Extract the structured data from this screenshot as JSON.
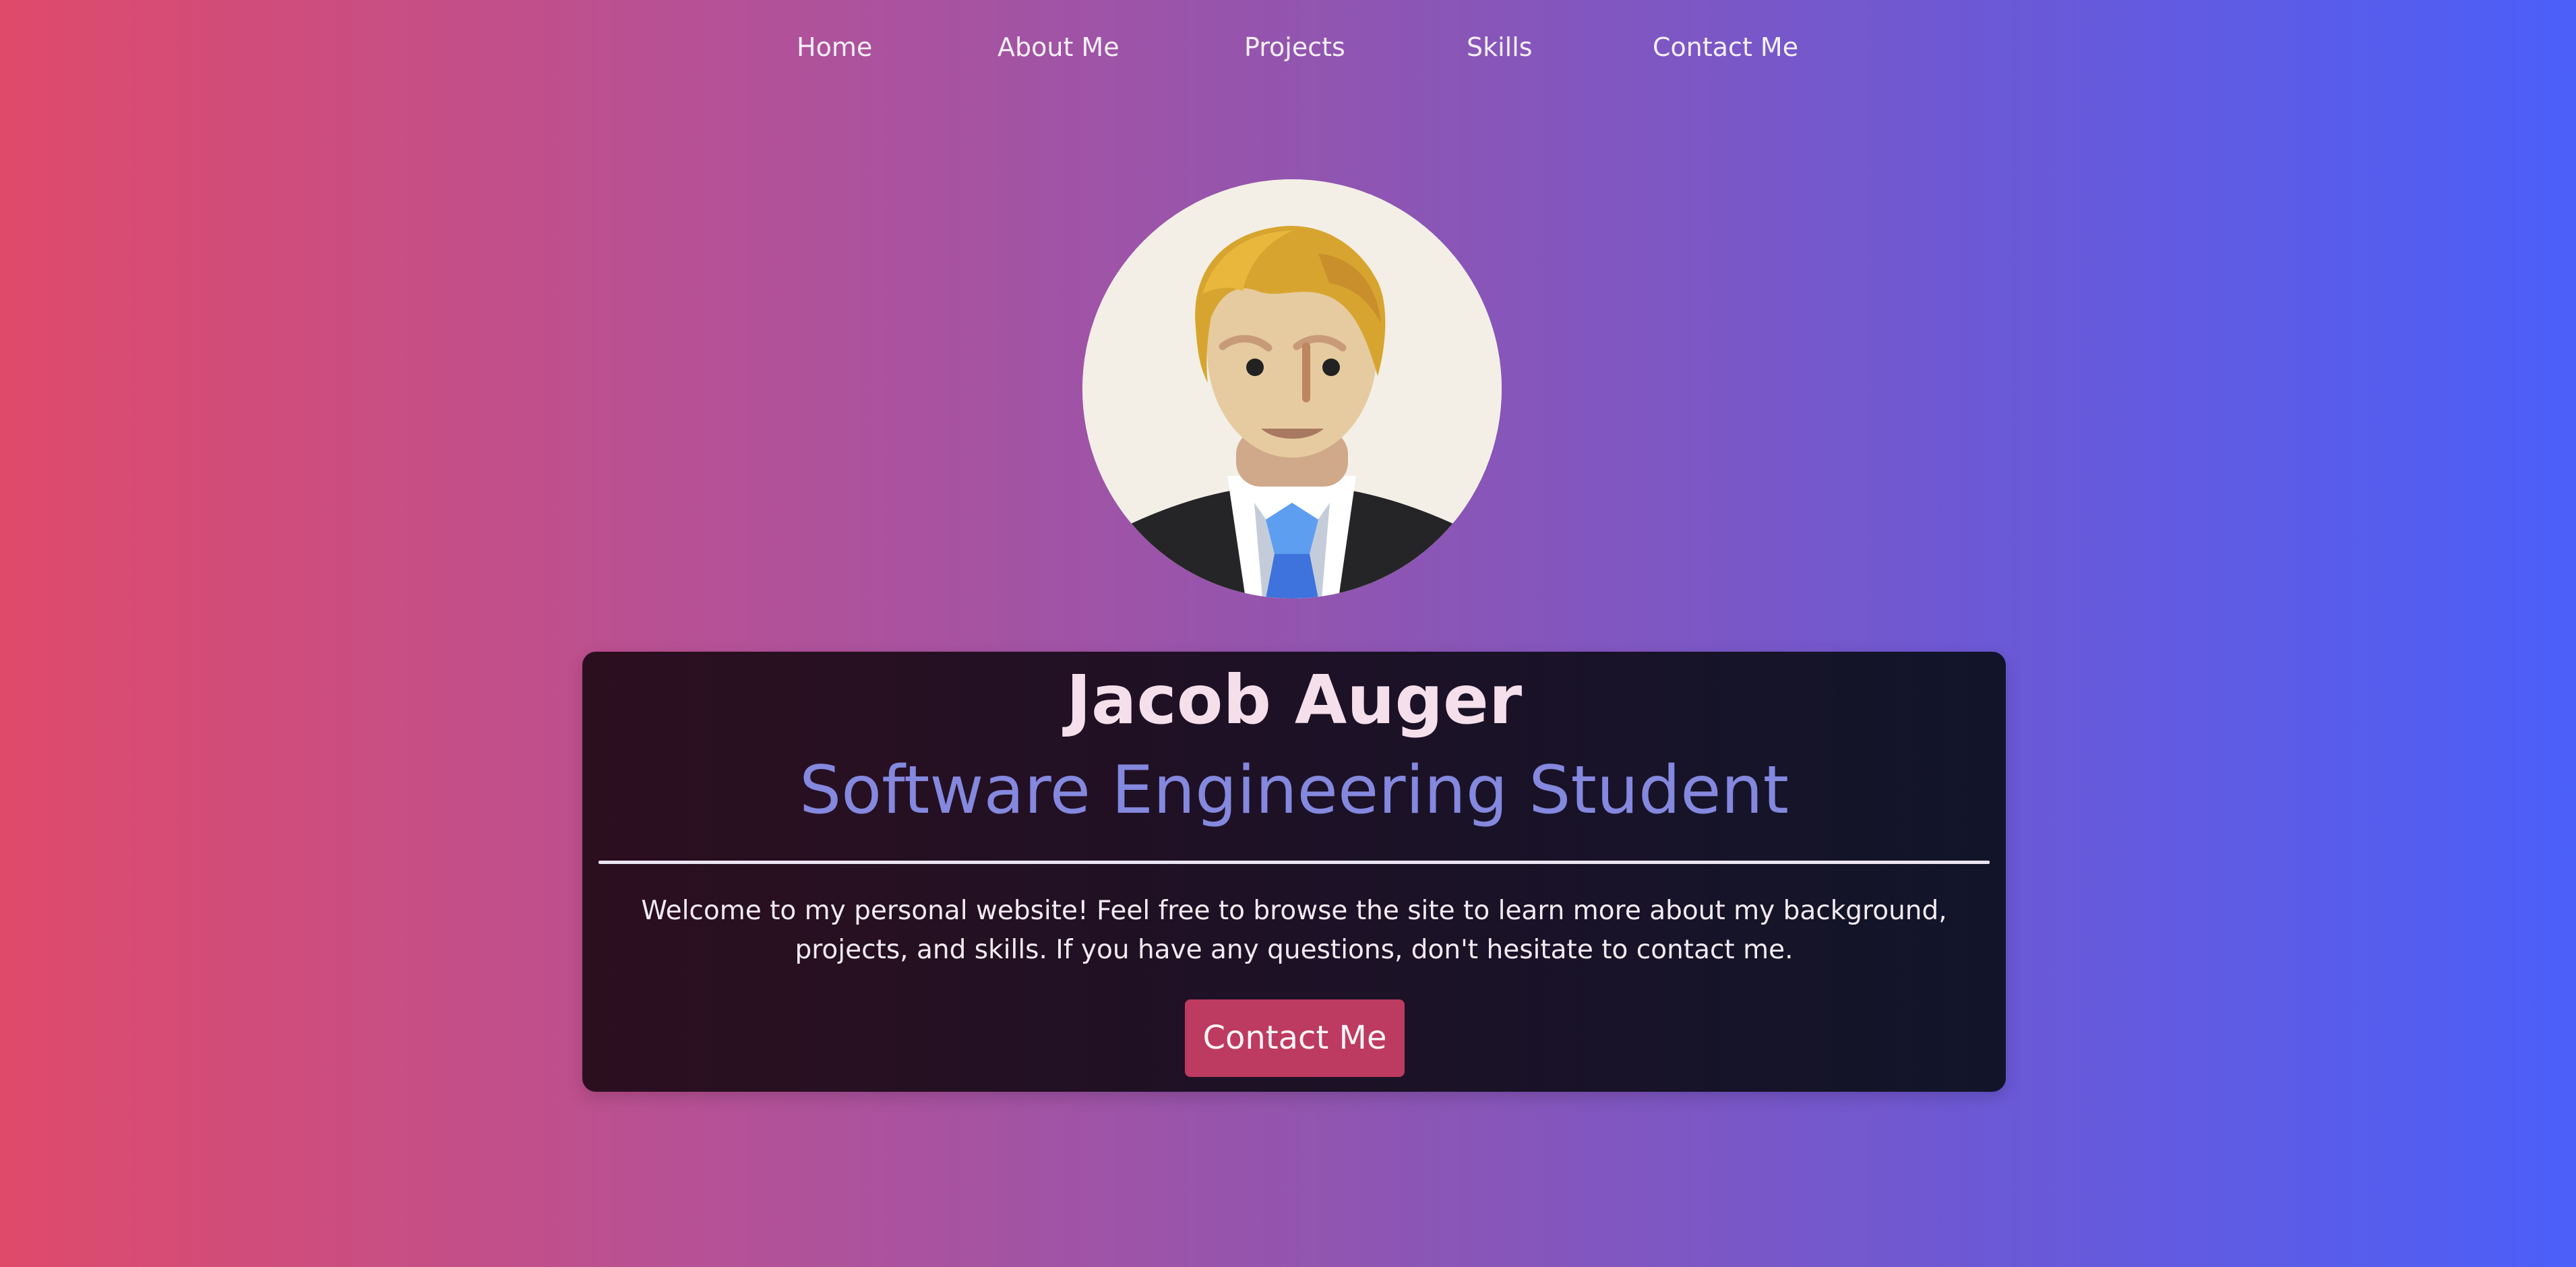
{
  "nav": {
    "items": [
      {
        "label": "Home"
      },
      {
        "label": "About Me"
      },
      {
        "label": "Projects"
      },
      {
        "label": "Skills"
      },
      {
        "label": "Contact Me"
      }
    ]
  },
  "profile": {
    "avatar_icon": "person-avatar-icon"
  },
  "hero": {
    "name": "Jacob Auger",
    "subtitle": "Software Engineering Student",
    "welcome": "Welcome to my personal website! Feel free to browse the site to learn more about my background, projects, and skills. If you have any questions, don't hesitate to contact me.",
    "cta_label": "Contact Me"
  },
  "colors": {
    "gradient_start": "#df4a6b",
    "gradient_end": "#4b5ff9",
    "card_bg": "#1d1126",
    "subtitle": "#8488de",
    "button": "#bd3a60"
  }
}
